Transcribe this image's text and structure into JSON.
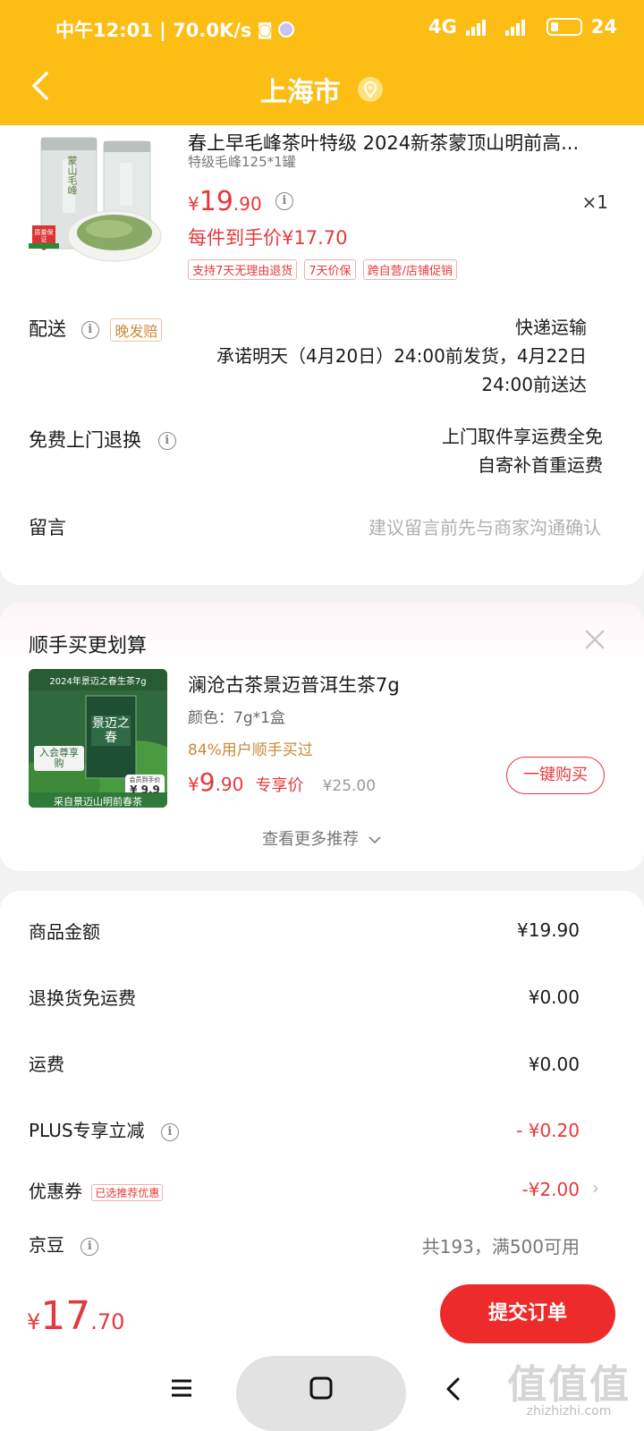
{
  "status_bar": {
    "time_speed": "中午12:01 | 70.0K/s",
    "network": "4G",
    "battery": "24"
  },
  "header": {
    "title": "上海市"
  },
  "product": {
    "title": "春上早毛峰茶叶特级 2024新茶蒙顶山明前高...",
    "spec": "特级毛峰125*1罐",
    "price_yen": "¥",
    "price_int": "19",
    "price_dec": ".90",
    "quantity": "×1",
    "hand_price": "每件到手价¥17.70",
    "tags": [
      "支持7天无理由退货",
      "7天价保",
      "跨自营/店铺促销"
    ],
    "image_text": "蒙山毛峰",
    "badge_text": "质量保证"
  },
  "delivery": {
    "label": "配送",
    "late_tag": "晚发赔",
    "method": "快递运输",
    "line1": "承诺明天（4月20日）24:00前发货，4月22日",
    "line2": "24:00前送达"
  },
  "return_service": {
    "label": "免费上门退换",
    "line1": "上门取件享运费全免",
    "line2": "自寄补首重运费"
  },
  "message": {
    "label": "留言",
    "placeholder": "建议留言前先与商家沟通确认"
  },
  "recommend": {
    "title": "顺手买更划算",
    "name": "澜沧古茶景迈普洱生茶7g",
    "spec": "颜色：7g*1盒",
    "bought": "84%用户顺手买过",
    "price_yen": "¥",
    "price_int": "9",
    "price_dec": ".90",
    "exclusive": "专享价",
    "original": "¥25.00",
    "buy_label": "一键购买",
    "more_label": "查看更多推荐",
    "image_banner": "2024年景迈之春生茶7g",
    "image_box_text": "景迈之春",
    "image_footer": "采自景迈山明前春茶",
    "image_member": "入会尊享购",
    "image_price_label": "会员到手价",
    "image_price": "¥ 9.9"
  },
  "summary": {
    "rows": [
      {
        "label": "商品金额",
        "value": "¥19.90"
      },
      {
        "label": "退换货免运费",
        "value": "¥0.00"
      },
      {
        "label": "运费",
        "value": "¥0.00"
      },
      {
        "label": "PLUS专享立减",
        "value": "- ¥0.20"
      },
      {
        "label": "优惠券",
        "value": "-¥2.00",
        "tag": "已选推荐优惠"
      },
      {
        "label": "京豆",
        "value": "共193，满500可用"
      }
    ]
  },
  "footer": {
    "total_yen": "¥",
    "total_int": "17",
    "total_dec": ".70",
    "submit_label": "提交订单"
  },
  "watermark": {
    "big": "值值值",
    "small": "zhizhizhi.com"
  },
  "colors": {
    "header": "#fcbd14",
    "accent_red": "#e4393c",
    "submit": "#ee2b2b"
  }
}
